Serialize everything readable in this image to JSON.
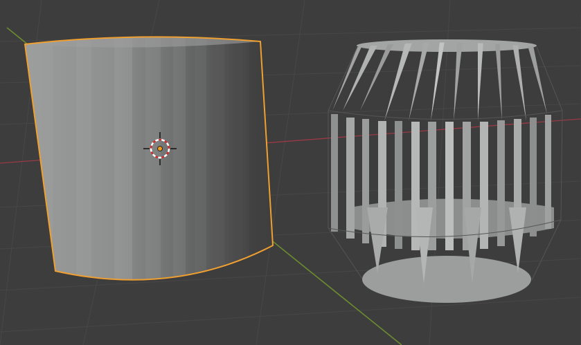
{
  "app": "3D Viewport",
  "scene": {
    "objects": [
      {
        "name": "cylinder",
        "state": "selected",
        "outline_color": "#f0a030"
      },
      {
        "name": "striped-barrel",
        "state": "unselected"
      }
    ],
    "cursor": {
      "name": "3d-cursor"
    },
    "axes": {
      "x_color": "#9a3a45",
      "y_color": "#6c8d2f"
    },
    "colors": {
      "background": "#3d3d3d",
      "grid": "#4a4a4a",
      "selection": "#f0a030",
      "origin": "#f29b1c"
    }
  }
}
